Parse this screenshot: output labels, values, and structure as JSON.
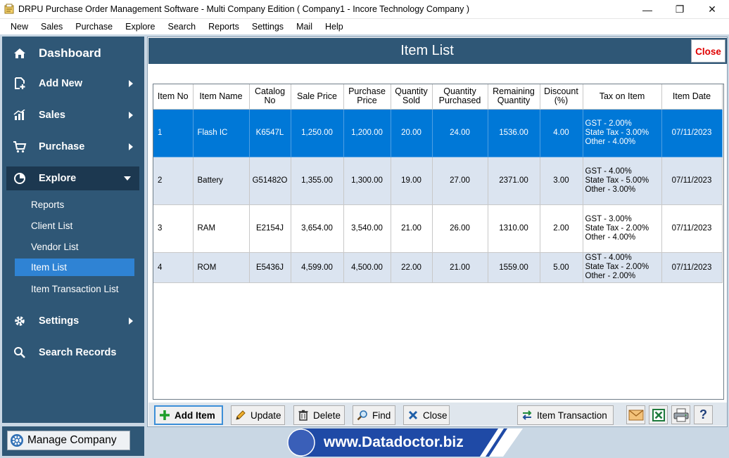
{
  "window": {
    "title": "DRPU Purchase Order Management Software - Multi Company Edition ( Company1 - Incore Technology Company )",
    "controls": {
      "minimize": "—",
      "restore": "❐",
      "close": "✕"
    }
  },
  "menu": [
    "New",
    "Sales",
    "Purchase",
    "Explore",
    "Search",
    "Reports",
    "Settings",
    "Mail",
    "Help"
  ],
  "sidebar": {
    "dashboard": "Dashboard",
    "add_new": "Add New",
    "sales": "Sales",
    "purchase": "Purchase",
    "explore": "Explore",
    "explore_items": [
      "Reports",
      "Client List",
      "Vendor List",
      "Item List",
      "Item Transaction List"
    ],
    "active_item": "Item List",
    "settings": "Settings",
    "search_records": "Search Records",
    "manage_company": "Manage Company"
  },
  "panel": {
    "title": "Item List",
    "close_label": "Close"
  },
  "table": {
    "headers": [
      "Item No",
      "Item Name",
      "Catalog No",
      "Sale Price",
      "Purchase Price",
      "Quantity Sold",
      "Quantity Purchased",
      "Remaining Quantity",
      "Discount (%)",
      "Tax on Item",
      "Item Date"
    ],
    "rows": [
      {
        "no": "1",
        "name": "Flash IC",
        "catalog": "K6547L",
        "sale": "1,250.00",
        "purchase": "1,200.00",
        "sold": "20.00",
        "purchased": "24.00",
        "remaining": "1536.00",
        "discount": "4.00",
        "tax": [
          "GST - 2.00%",
          "State Tax - 3.00%",
          "Other - 4.00%"
        ],
        "date": "07/11/2023"
      },
      {
        "no": "2",
        "name": "Battery",
        "catalog": "G51482O",
        "sale": "1,355.00",
        "purchase": "1,300.00",
        "sold": "19.00",
        "purchased": "27.00",
        "remaining": "2371.00",
        "discount": "3.00",
        "tax": [
          "GST - 4.00%",
          "State Tax - 5.00%",
          "Other - 3.00%"
        ],
        "date": "07/11/2023"
      },
      {
        "no": "3",
        "name": "RAM",
        "catalog": "E2154J",
        "sale": "3,654.00",
        "purchase": "3,540.00",
        "sold": "21.00",
        "purchased": "26.00",
        "remaining": "1310.00",
        "discount": "2.00",
        "tax": [
          "GST - 3.00%",
          "State Tax - 2.00%",
          "Other - 4.00%"
        ],
        "date": "07/11/2023"
      },
      {
        "no": "4",
        "name": "ROM",
        "catalog": "E5436J",
        "sale": "4,599.00",
        "purchase": "4,500.00",
        "sold": "22.00",
        "purchased": "21.00",
        "remaining": "1559.00",
        "discount": "5.00",
        "tax": [
          "GST - 4.00%",
          "State Tax - 2.00%",
          "Other - 2.00%"
        ],
        "date": "07/11/2023"
      }
    ]
  },
  "toolbar": {
    "add_item": "Add Item",
    "update": "Update",
    "delete": "Delete",
    "find": "Find",
    "close": "Close",
    "item_transaction": "Item Transaction",
    "help": "?"
  },
  "footer": {
    "website": "www.Datadoctor.biz"
  },
  "colors": {
    "sidebar_bg": "#2f5776",
    "sidebar_active": "#1c3850",
    "subitem_active": "#2f83d4",
    "row_selected": "#0078d7",
    "row_alt": "#dbe4f0",
    "close_red": "#e00000",
    "banner_blue": "#1f4aa6"
  }
}
